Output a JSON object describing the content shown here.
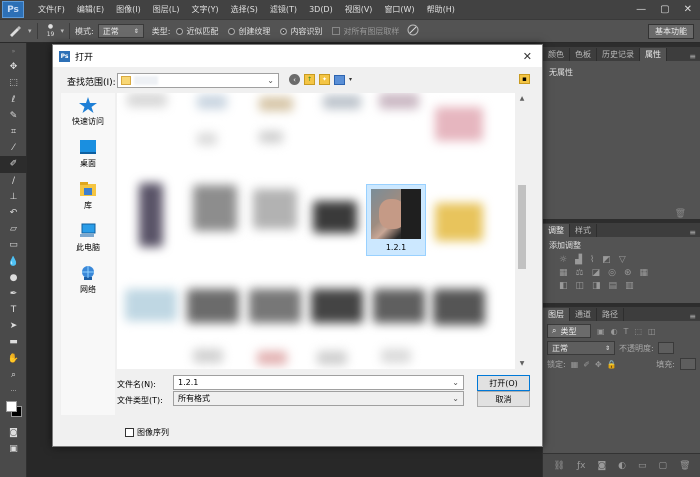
{
  "app": {
    "logo": "Ps",
    "menu": [
      "文件(F)",
      "编辑(E)",
      "图像(I)",
      "图层(L)",
      "文字(Y)",
      "选择(S)",
      "滤镜(T)",
      "3D(D)",
      "视图(V)",
      "窗口(W)",
      "帮助(H)"
    ],
    "window_controls": [
      "—",
      "▢",
      "✕"
    ]
  },
  "options": {
    "brush_size": "19",
    "mode_label": "模式:",
    "mode_value": "正常",
    "type_label": "类型:",
    "type_options": [
      "近似匹配",
      "创建纹理",
      "内容识别"
    ],
    "type_selected": "内容识别",
    "sample_all": "对所有图层取样",
    "workspace": "基本功能"
  },
  "right_panel": {
    "top_tabs": [
      "颜色",
      "色板",
      "历史记录",
      "属性"
    ],
    "top_active": "属性",
    "properties_text": "无属性",
    "adjust_tabs": [
      "调整",
      "样式"
    ],
    "adjust_title": "添加调整",
    "layer_tabs": [
      "图层",
      "通道",
      "路径"
    ],
    "layer_kind": "类型",
    "blend_mode": "正常",
    "opacity_label": "不透明度:",
    "lock_label": "锁定:",
    "fill_label": "填充:"
  },
  "dialog": {
    "title": "打开",
    "lookin_label": "查找范围(I):",
    "places": [
      "快速访问",
      "桌面",
      "库",
      "此电脑",
      "网络"
    ],
    "selected_file": "1.2.1",
    "filename_label": "文件名(N):",
    "filename_value": "1.2.1",
    "filetype_label": "文件类型(T):",
    "filetype_value": "所有格式",
    "open_button": "打开(O)",
    "cancel_button": "取消",
    "sequence_label": "图像序列"
  }
}
